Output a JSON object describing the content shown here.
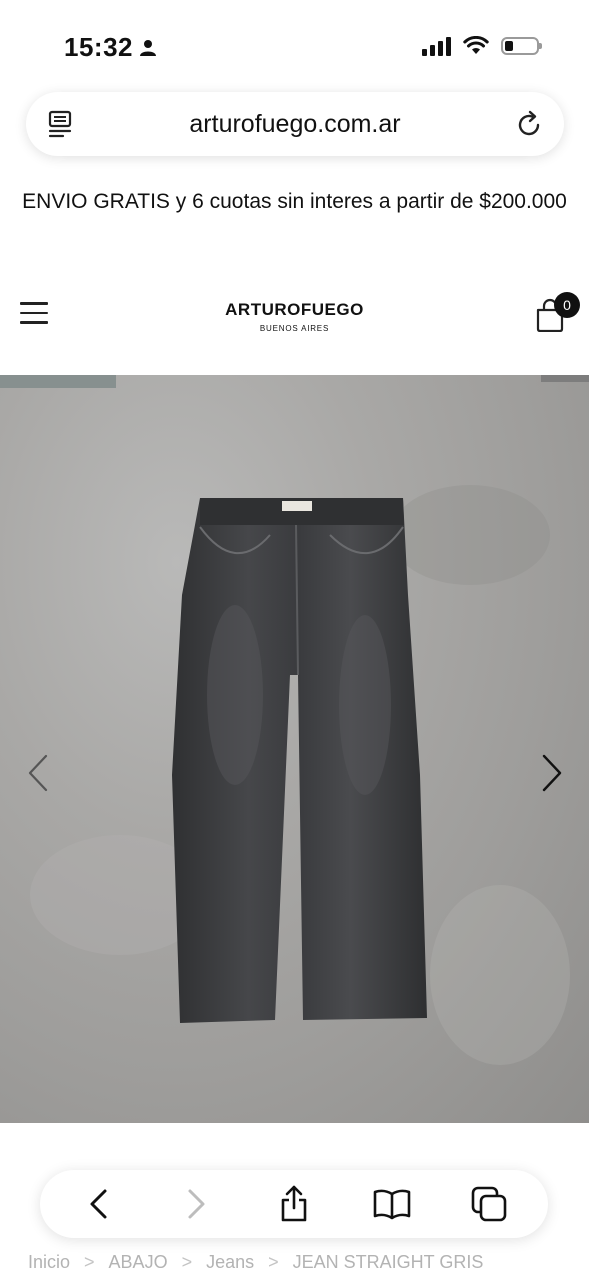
{
  "status_bar": {
    "time": "15:32",
    "battery_level": 0.25
  },
  "browser": {
    "url": "arturofuego.com.ar"
  },
  "promo_text": "ENVIO GRATIS y 6 cuotas sin interes a partir de $200.000",
  "header": {
    "brand": "ARTUROFUEGO",
    "tagline": "BUENOS AIRES",
    "cart_count": "0"
  },
  "product_image": {
    "description_icon": "jeans-photo",
    "colors": {
      "background": "#a3a2a0",
      "denim": "#3a3b3d"
    }
  },
  "breadcrumb": {
    "items": [
      "Inicio",
      "ABAJO",
      "Jeans",
      "JEAN STRAIGHT GRIS"
    ],
    "separator": ">"
  },
  "icons": {
    "status": [
      "person-icon",
      "signal-icon",
      "wifi-icon",
      "battery-icon"
    ],
    "url_bar": [
      "reader-icon",
      "reload-icon"
    ],
    "header": [
      "menu-icon",
      "cart-icon"
    ],
    "toolbar": [
      "back-icon",
      "forward-icon",
      "share-icon",
      "bookmarks-icon",
      "tabs-icon"
    ]
  }
}
